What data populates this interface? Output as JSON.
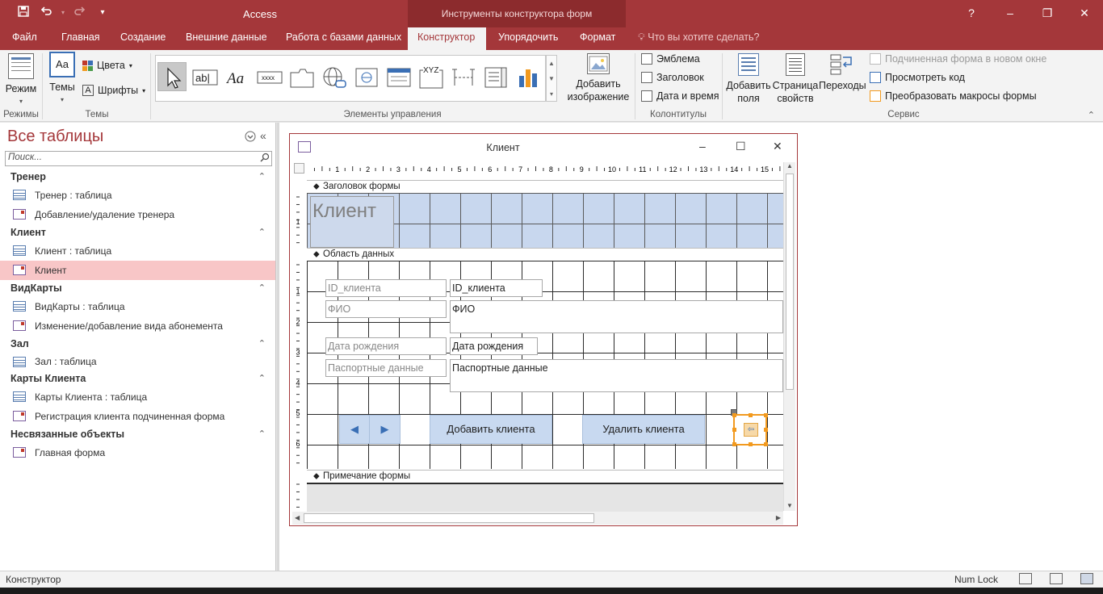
{
  "app": {
    "title": "Access",
    "context_tab_group": "Инструменты конструктора форм",
    "window_controls": {
      "help": "?",
      "minimize": "–",
      "restore": "❐",
      "close": "✕"
    }
  },
  "qat": {
    "save_icon": "save-icon",
    "undo_icon": "undo-icon",
    "redo_icon": "redo-icon",
    "customize_icon": "customize-icon"
  },
  "tabs": [
    {
      "label": "Файл"
    },
    {
      "label": "Главная"
    },
    {
      "label": "Создание"
    },
    {
      "label": "Внешние данные"
    },
    {
      "label": "Работа с базами данных"
    },
    {
      "label": "Конструктор",
      "active": true
    },
    {
      "label": "Упорядочить"
    },
    {
      "label": "Формат"
    }
  ],
  "tell_me": "Что вы хотите сделать?",
  "ribbon": {
    "modes": {
      "view_label": "Режим",
      "group": "Режимы"
    },
    "themes": {
      "themes_label": "Темы",
      "colors_label": "Цвета",
      "fonts_label": "Шрифты",
      "group": "Темы"
    },
    "controls": {
      "group": "Элементы управления",
      "add_image_label": "Добавить изображение"
    },
    "header_footer": {
      "logo": "Эмблема",
      "title": "Заголовок",
      "datetime": "Дата и время",
      "group": "Колонтитулы"
    },
    "tools": {
      "add_fields": "Добавить поля",
      "property_sheet": "Страница свойств",
      "tab_order": "Переходы",
      "subform_new_window": "Подчиненная форма в новом окне",
      "view_code": "Просмотреть код",
      "convert_macros": "Преобразовать макросы формы",
      "group": "Сервис"
    }
  },
  "nav": {
    "title": "Все таблицы",
    "search_placeholder": "Поиск...",
    "groups": [
      {
        "name": "Тренер",
        "items": [
          {
            "label": "Тренер : таблица",
            "kind": "table"
          },
          {
            "label": "Добавление/удаление тренера",
            "kind": "form"
          }
        ]
      },
      {
        "name": "Клиент",
        "items": [
          {
            "label": "Клиент : таблица",
            "kind": "table"
          },
          {
            "label": "Клиент",
            "kind": "form",
            "selected": true
          }
        ]
      },
      {
        "name": "ВидКарты",
        "items": [
          {
            "label": "ВидКарты : таблица",
            "kind": "table"
          },
          {
            "label": "Изменение/добавление вида абонемента",
            "kind": "form"
          }
        ]
      },
      {
        "name": "Зал",
        "items": [
          {
            "label": "Зал : таблица",
            "kind": "table"
          }
        ]
      },
      {
        "name": "Карты Клиента",
        "items": [
          {
            "label": "Карты Клиента : таблица",
            "kind": "table"
          },
          {
            "label": "Регистрация клиента подчиненная форма",
            "kind": "form"
          }
        ]
      },
      {
        "name": "Несвязанные объекты",
        "items": [
          {
            "label": "Главная форма",
            "kind": "form"
          }
        ]
      }
    ]
  },
  "form_window": {
    "title": "Клиент",
    "ruler_h": [
      "1",
      "2",
      "3",
      "4",
      "5",
      "6",
      "7",
      "8",
      "9",
      "10",
      "11",
      "12",
      "13",
      "14",
      "15"
    ],
    "ruler_v_hdr": [
      "1"
    ],
    "ruler_v_detail": [
      "1",
      "2",
      "3",
      "4",
      "5",
      "6"
    ],
    "sections": {
      "header": "Заголовок формы",
      "detail": "Область данных",
      "footer": "Примечание формы"
    },
    "header_title": "Клиент",
    "fields": [
      {
        "label": "ID_клиента",
        "control": "ID_клиента"
      },
      {
        "label": "ФИО",
        "control": "ФИО"
      },
      {
        "label": "Дата рождения",
        "control": "Дата рождения"
      },
      {
        "label": "Паспортные данные",
        "control": "Паспортные данные"
      }
    ],
    "buttons": {
      "prev": "◀",
      "next": "▶",
      "add": "Добавить клиента",
      "delete": "Удалить клиента"
    }
  },
  "status": {
    "mode": "Конструктор",
    "num_lock": "Num Lock"
  }
}
